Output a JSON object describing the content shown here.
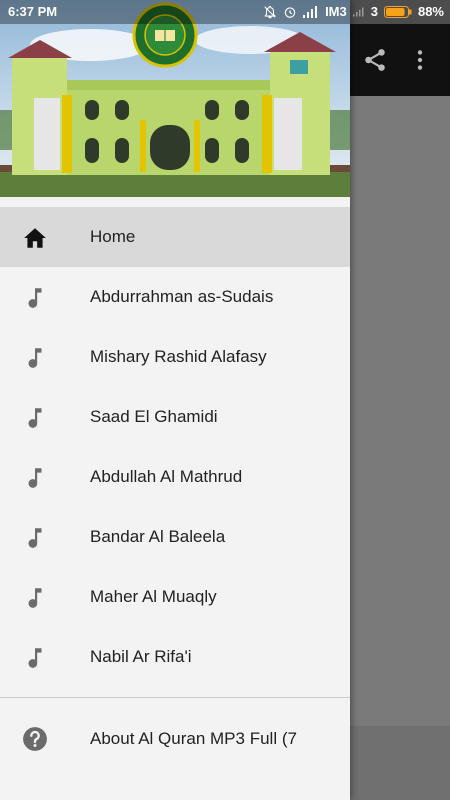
{
  "status_bar": {
    "time": "6:37 PM",
    "carrier": "IM3",
    "sim_slot": "3",
    "battery": "88%",
    "battery_level": 0.88
  },
  "toolbar": {
    "share_icon": "share-icon",
    "overflow_icon": "more-vert-icon"
  },
  "drawer": {
    "header_image": "mosque-building-photo",
    "logo": "circular-green-emblem",
    "menu": [
      {
        "label": "Home",
        "icon": "home-icon",
        "selected": true
      },
      {
        "label": "Abdurrahman as-Sudais",
        "icon": "music-note-icon"
      },
      {
        "label": "Mishary Rashid Alafasy",
        "icon": "music-note-icon"
      },
      {
        "label": "Saad El Ghamidi",
        "icon": "music-note-icon"
      },
      {
        "label": "Abdullah Al Mathrud",
        "icon": "music-note-icon"
      },
      {
        "label": "Bandar Al Baleela",
        "icon": "music-note-icon"
      },
      {
        "label": "Maher Al Muaqly",
        "icon": "music-note-icon"
      },
      {
        "label": "Nabil Ar Rifa'i",
        "icon": "music-note-icon"
      }
    ],
    "about": {
      "label": "About Al Quran MP3 Full (7",
      "icon": "help-icon"
    }
  },
  "colors": {
    "accent_green": "#2e8b3a",
    "scrim": "#777777",
    "selected_bg": "#d9d9d9"
  }
}
